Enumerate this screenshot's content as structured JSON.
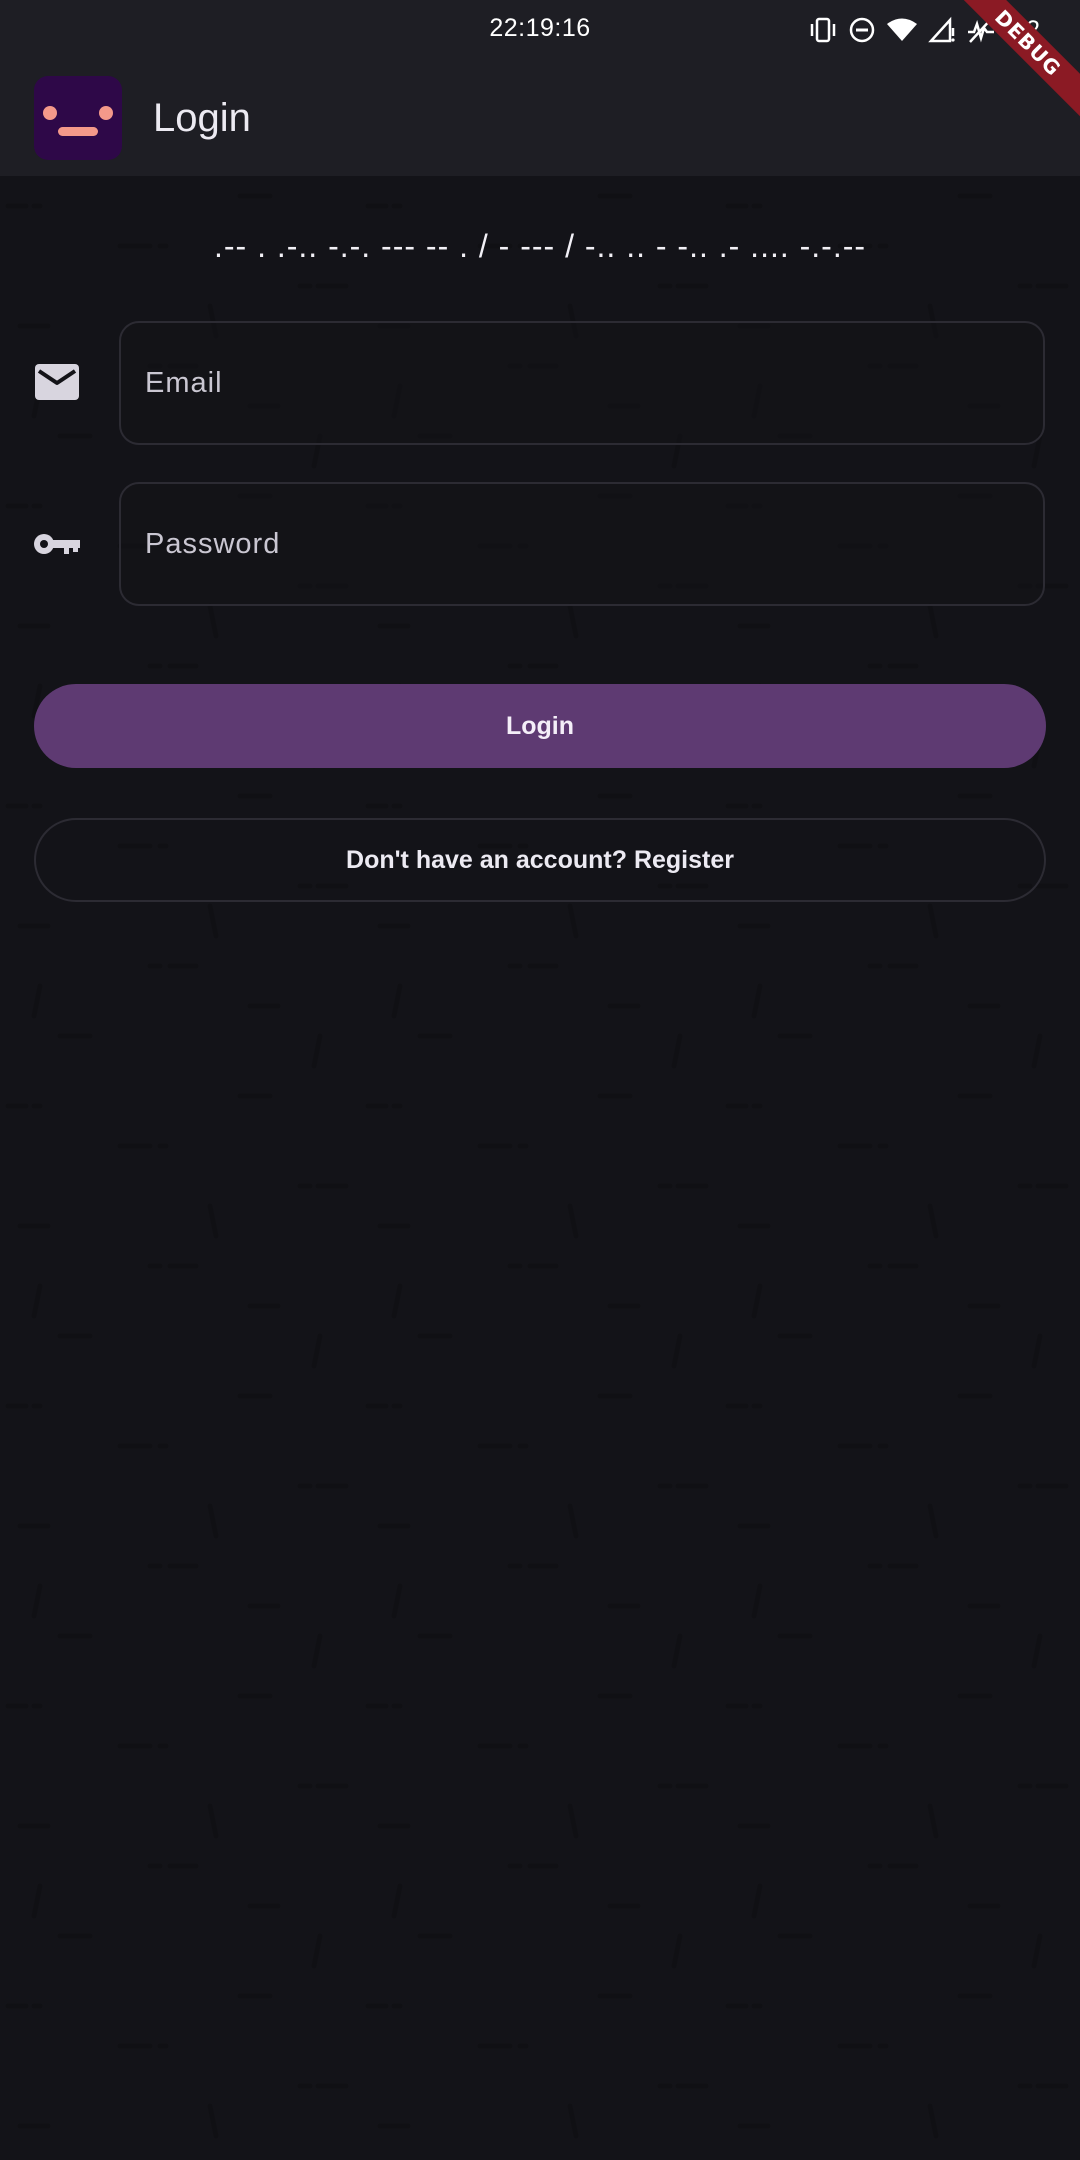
{
  "status_bar": {
    "time": "22:19:16",
    "battery": "12",
    "icons": [
      "vibrate-icon",
      "do-not-disturb-icon",
      "wifi-icon",
      "signal-icon",
      "data-off-icon"
    ]
  },
  "app_bar": {
    "title": "Login",
    "logo_icon": "face-logo-icon"
  },
  "debug_banner": "DEBUG",
  "login": {
    "subtitle": ".-- . .-.. -.-. --- -- . / - --- / -.. .. - -.. .- .... -.-.--",
    "email": {
      "placeholder": "Email",
      "value": "",
      "icon": "mail-icon"
    },
    "password": {
      "placeholder": "Password",
      "value": "",
      "icon": "key-icon"
    },
    "login_button": "Login",
    "register_button": "Don't have an account? Register"
  },
  "colors": {
    "background": "#131318",
    "app_bar": "#1e1e24",
    "primary_button": "#5e3a72",
    "logo_bg": "#2e0848",
    "logo_face": "#f4998a",
    "debug_banner": "#8b1a24",
    "field_border": "#2c2b33"
  }
}
